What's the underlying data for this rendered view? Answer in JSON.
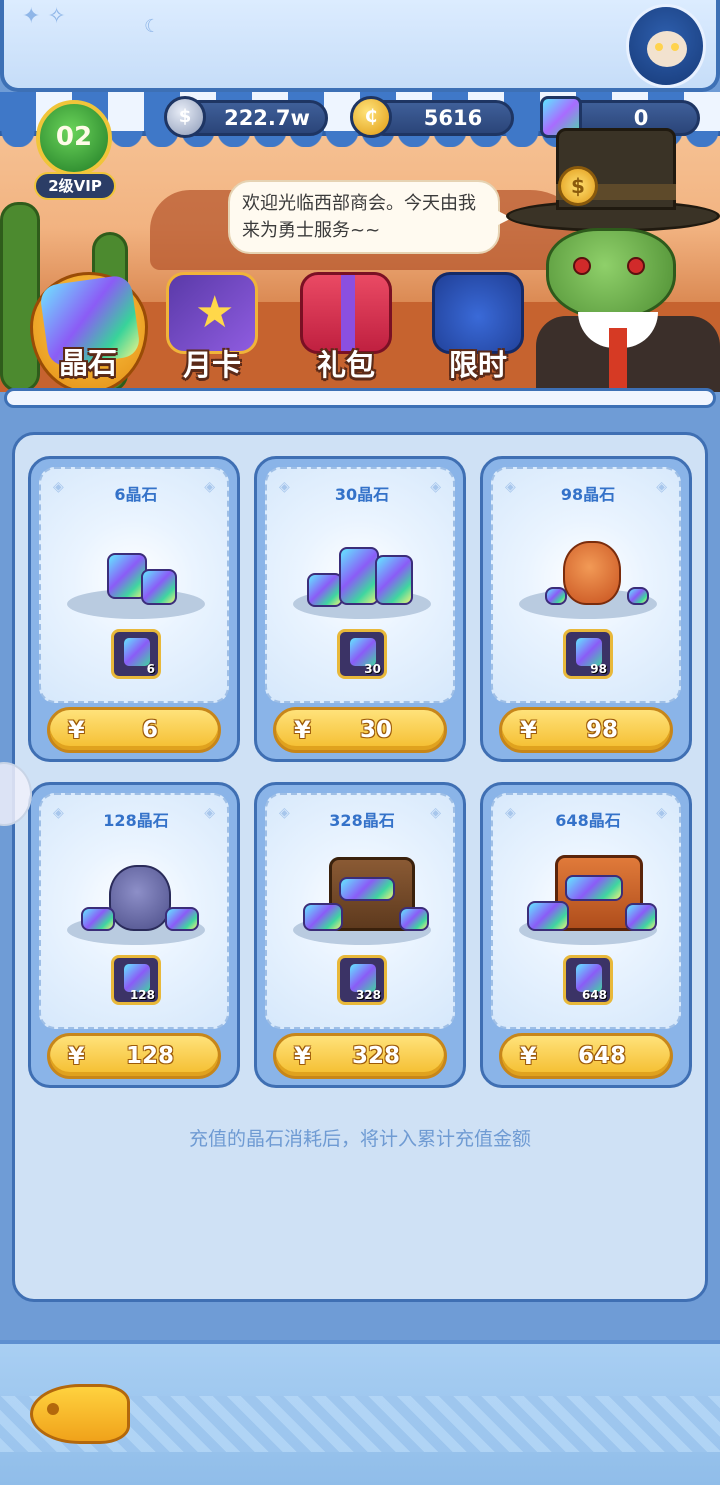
{
  "currency": {
    "silver": "222.7w",
    "gold": "5616",
    "crystal": "0"
  },
  "vip": {
    "level": "02",
    "label": "2级VIP"
  },
  "npc": {
    "greeting": "欢迎光临西部商会。今天由我来为勇士服务~~"
  },
  "tabs": [
    {
      "label": "晶石",
      "active": true
    },
    {
      "label": "月卡",
      "active": false
    },
    {
      "label": "礼包",
      "active": false
    },
    {
      "label": "限时",
      "active": false
    }
  ],
  "products": [
    {
      "title": "6晶石",
      "badge": "6",
      "price": "6"
    },
    {
      "title": "30晶石",
      "badge": "30",
      "price": "30"
    },
    {
      "title": "98晶石",
      "badge": "98",
      "price": "98"
    },
    {
      "title": "128晶石",
      "badge": "128",
      "price": "128"
    },
    {
      "title": "328晶石",
      "badge": "328",
      "price": "328"
    },
    {
      "title": "648晶石",
      "badge": "648",
      "price": "648"
    }
  ],
  "price_currency_symbol": "¥",
  "footer_note": "充值的晶石消耗后，将计入累计充值金额",
  "icons": {
    "silver": "silver-coin-icon",
    "gold": "gold-coin-icon",
    "crystal": "crystal-icon"
  }
}
